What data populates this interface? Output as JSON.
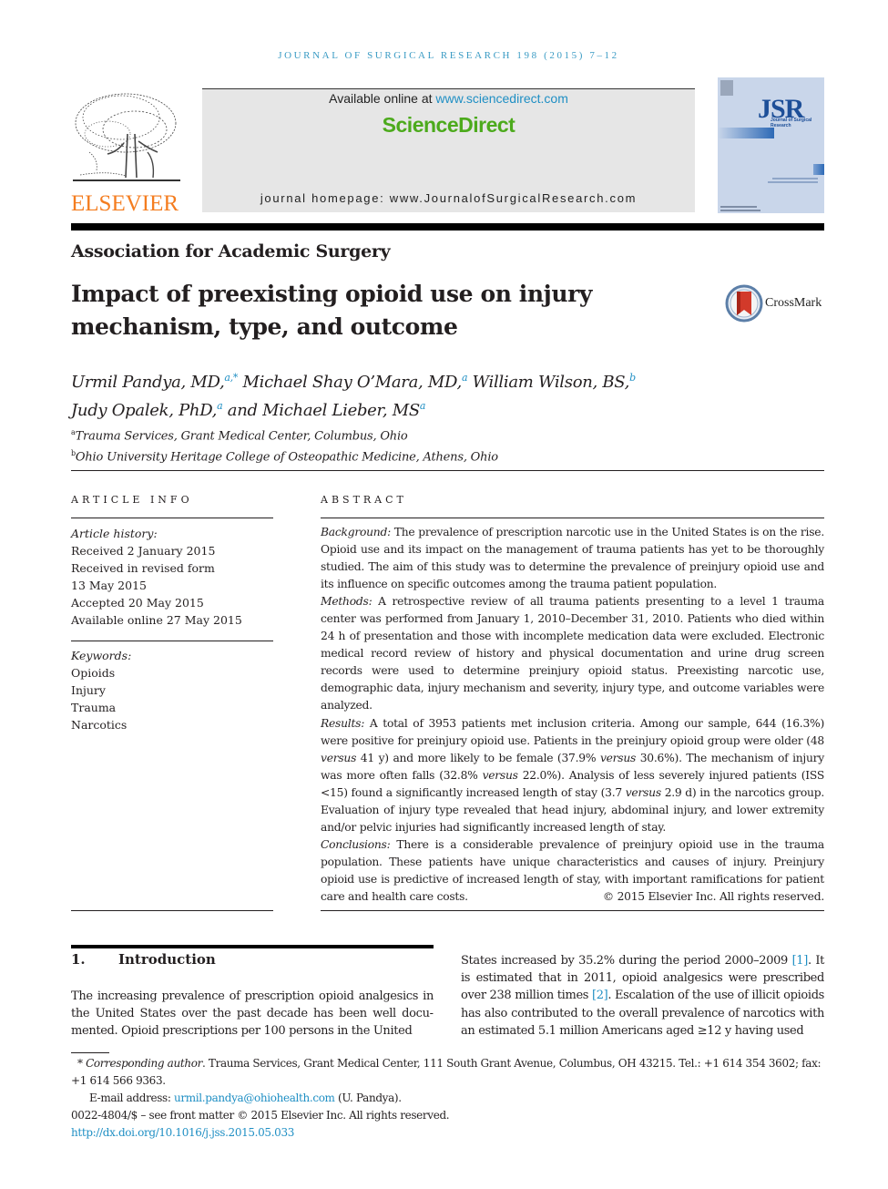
{
  "running_head": "JOURNAL OF SURGICAL RESEARCH 198 (2015) 7–12",
  "header": {
    "publisher_logo": "ELSEVIER",
    "available_online_prefix": "Available online at ",
    "available_online_link": "www.sciencedirect.com",
    "platform_logo": "ScienceDirect",
    "homepage_label": "journal homepage: www.JournalofSurgicalResearch.com",
    "cover": {
      "abbrev": "JSR",
      "subtitle": "Journal of Surgical Research"
    },
    "crossmark_label": "CrossMark",
    "colors": {
      "elsevier_orange": "#f47d20",
      "sciencedirect_green": "#4caa1c",
      "link_blue": "#1f8fc4",
      "header_band": "#e6e6e6",
      "cover_blue": "#c9d6ea"
    }
  },
  "article": {
    "section": "Association for Academic Surgery",
    "title_line1": "Impact of preexisting opioid use on injury",
    "title_line2": "mechanism, type, and outcome",
    "authors": [
      {
        "name": "Urmil Pandya, MD,",
        "sup": "a,*"
      },
      {
        "name": "Michael Shay O’Mara, MD,",
        "sup": "a"
      },
      {
        "name": "William Wilson, BS,",
        "sup": "b"
      },
      {
        "name": "Judy Opalek, PhD,",
        "sup": "a"
      },
      {
        "name": "and Michael Lieber, MS",
        "sup": "a"
      }
    ],
    "affiliations": [
      {
        "mark": "a",
        "text": "Trauma Services, Grant Medical Center, Columbus, Ohio"
      },
      {
        "mark": "b",
        "text": "Ohio University Heritage College of Osteopathic Medicine, Athens, Ohio"
      }
    ]
  },
  "article_info": {
    "heading": "ARTICLE INFO",
    "history_label": "Article history:",
    "history": [
      "Received 2 January 2015",
      "Received in revised form",
      "13 May 2015",
      "Accepted 20 May 2015",
      "Available online 27 May 2015"
    ],
    "keywords_label": "Keywords:",
    "keywords": [
      "Opioids",
      "Injury",
      "Trauma",
      "Narcotics"
    ]
  },
  "abstract": {
    "heading": "ABSTRACT",
    "background_label": "Background:",
    "background": " The prevalence of prescription narcotic use in the United States is on the rise. Opioid use and its impact on the management of trauma patients has yet to be thoroughly studied. The aim of this study was to determine the prevalence of preinjury opioid use and its influence on specific outcomes among the trauma patient population.",
    "methods_label": "Methods:",
    "methods": " A retrospective review of all trauma patients presenting to a level 1 trauma center was performed from January 1, 2010–December 31, 2010. Patients who died within 24 h of presentation and those with incomplete medication data were excluded. Electronic med­ical record review of history and physical documentation and urine drug screen records were used to determine preinjury opioid status. Preexisting narcotic use, demographic data, injury mechanism and severity, injury type, and outcome variables were analyzed.",
    "results_label": "Results:",
    "results_1": " A total of 3953 patients met inclusion criteria. Among our sample, 644 (16.3%) were positive for preinjury opioid use. Patients in the preinjury opioid group were older (48 ",
    "versus": "versus",
    "results_2": " 41 y) and more likely to be female (37.9% ",
    "results_3": " 30.6%). The mechanism of injury was more often falls (32.8% ",
    "results_4": " 22.0%). Analysis of less severely injured patients (ISS <15) found a significantly increased length of stay (3.7 ",
    "results_5": " 2.9 d) in the narcotics group. Evaluation of injury type revealed that head injury, abdominal injury, and lower extremity and/or pelvic injuries had significantly increased length of stay.",
    "conclusions_label": "Conclusions:",
    "conclusions": " There is a considerable prevalence of preinjury opioid use in the trauma population. These patients have unique characteristics and causes of injury. Preinjury opioid use is predictive of increased length of stay, with important ramifications for patient care and health care costs.",
    "copyright": "© 2015 Elsevier Inc. All rights reserved."
  },
  "introduction": {
    "number": "1.",
    "heading": "Introduction",
    "left_text": "The increasing prevalence of prescription opioid analgesics in the United States over the past decade has been well docu­mented. Opioid prescriptions per 100 persons in the United",
    "right_1": "States increased by 35.2% during the period 2000–2009 ",
    "ref1": "[1]",
    "right_2": ". It is estimated that in 2011, opioid analgesics were prescribed over 238 million times ",
    "ref2": "[2]",
    "right_3": ". Escalation of the use of illicit opioids has also contributed to the overall prevalence of narcotics with an estimated 5.1 million Americans aged ≥12 y having used"
  },
  "footnotes": {
    "star": "*",
    "corresponding_label": "Corresponding author",
    "corresponding_text": ". Trauma Services, Grant Medical Center, 111 South Grant Avenue, Columbus, OH 43215. Tel.: +1 614 354 3602; fax: +1 614 566 9363.",
    "email_label": "E-mail address: ",
    "email": "urmil.pandya@ohiohealth.com",
    "email_suffix": " (U. Pandya).",
    "front_matter": "0022-4804/$ – see front matter © 2015 Elsevier Inc. All rights reserved.",
    "doi": "http://dx.doi.org/10.1016/j.jss.2015.05.033"
  }
}
